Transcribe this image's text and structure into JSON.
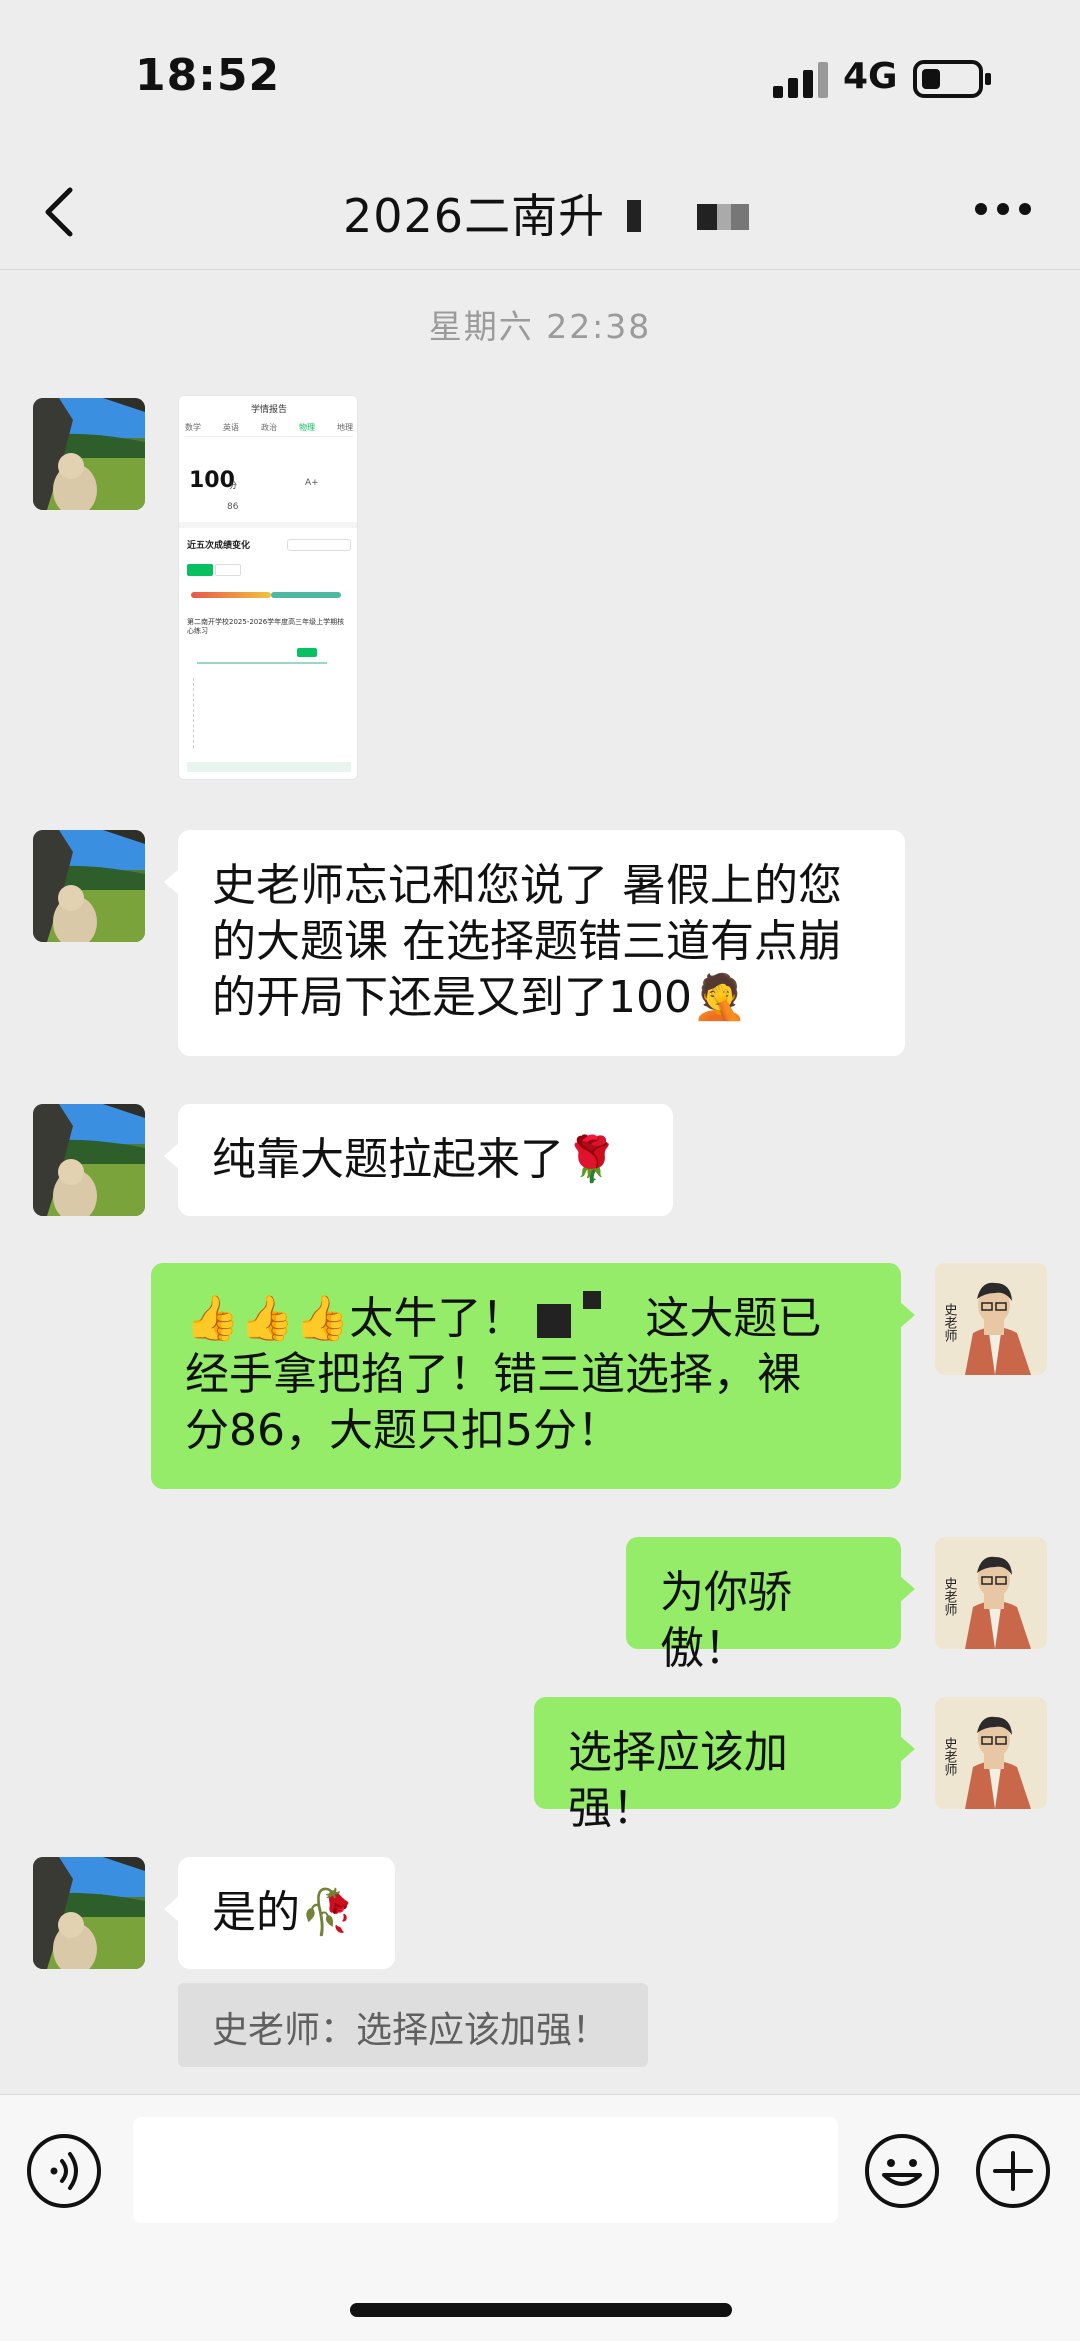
{
  "status_bar": {
    "time": "18:52",
    "network": "4G"
  },
  "nav": {
    "title": "2026二南升"
  },
  "timestamp": "星期六 22:38",
  "screenshot": {
    "header": "学情报告",
    "tabs": [
      "数学",
      "英语",
      "政治",
      "物理",
      "地理"
    ],
    "score": "100",
    "score_unit": "分",
    "grade": "A+",
    "objective_score": "86",
    "section_title": "近五次成绩变化",
    "exam_name": "第二南开学校2025-2026学年度高三年级上学期核心练习"
  },
  "messages": [
    {
      "text": "史老师忘记和您说了 暑假上的您的大题课 在选择题错三道有点崩的开局下还是又到了100🤦"
    },
    {
      "text": "纯靠大题拉起来了🌹"
    },
    {
      "line1": "👍👍👍太牛了！",
      "line1b": "这大题已",
      "line2": "经手拿把掐了！错三道选择，裸",
      "line3": "分86，大题只扣5分！"
    },
    {
      "text": "为你骄傲！"
    },
    {
      "text": "选择应该加强！"
    },
    {
      "text": "是的🥀"
    }
  ],
  "quote": {
    "text": "史老师：选择应该加强！"
  },
  "avatar_teacher": {
    "label": "史老师"
  },
  "input": {
    "placeholder": ""
  },
  "colors": {
    "background": "#ededed",
    "bubble_green": "#95ec69",
    "bubble_white": "#ffffff",
    "accent_green": "#07c160"
  },
  "icons": [
    "back-icon",
    "more-icon",
    "voice-icon",
    "emoji-icon",
    "plus-icon"
  ]
}
